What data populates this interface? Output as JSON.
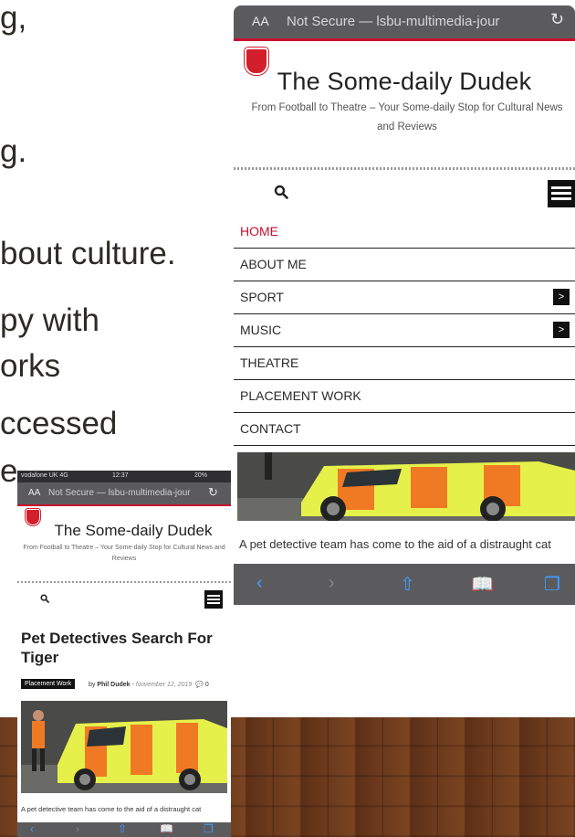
{
  "slide": {
    "fragments": [
      "g,",
      "g.",
      "bout culture.",
      "py with",
      "orks",
      "ccessed",
      "e."
    ]
  },
  "big_phone": {
    "url_bar": {
      "aa": "AA",
      "address": "Not Secure — lsbu-multimedia-jour"
    },
    "site_title": "The Some-daily Dudek",
    "site_subtitle": "From Football to Theatre – Your Some-daily Stop for Cultural News and Reviews",
    "menu": [
      {
        "label": "HOME",
        "active": true,
        "has_submenu": false
      },
      {
        "label": "ABOUT ME",
        "active": false,
        "has_submenu": false
      },
      {
        "label": "SPORT",
        "active": false,
        "has_submenu": true
      },
      {
        "label": "MUSIC",
        "active": false,
        "has_submenu": true
      },
      {
        "label": "THEATRE",
        "active": false,
        "has_submenu": false
      },
      {
        "label": "PLACEMENT WORK",
        "active": false,
        "has_submenu": false
      },
      {
        "label": "CONTACT",
        "active": false,
        "has_submenu": false
      }
    ],
    "submenu_arrow": ">",
    "caption": "A pet detective team has come to the aid of a distraught cat",
    "toolbar": {
      "back": "‹",
      "forward": "›",
      "share": "⇧",
      "bookmarks": "📖",
      "tabs": "❐"
    }
  },
  "small_phone": {
    "status": {
      "carrier": "vodafone UK 4G",
      "time": "12:37",
      "battery": "20%"
    },
    "url_bar": {
      "aa": "AA",
      "address": "Not Secure — lsbu-multimedia-jour"
    },
    "site_title": "The Some-daily Dudek",
    "site_subtitle": "From Football to Theatre – Your Some-daily Stop for Cultural News and Reviews",
    "article_title": "Pet Detectives Search For Tiger",
    "category_tag": "Placement Work",
    "byline_prefix": "by",
    "author": "Phil Dudek",
    "date": "November 12, 2019",
    "comments": "0",
    "caption": "A pet detective team has come to the aid of a distraught cat",
    "toolbar": {
      "back": "‹",
      "forward": "›",
      "share": "⇧",
      "bookmarks": "📖",
      "tabs": "❐"
    }
  },
  "colors": {
    "accent_red": "#c8102e",
    "ios_blue": "#3ea0ff",
    "browser_gray": "#5b5b5e",
    "floor_wood": "#6b3a1c"
  }
}
